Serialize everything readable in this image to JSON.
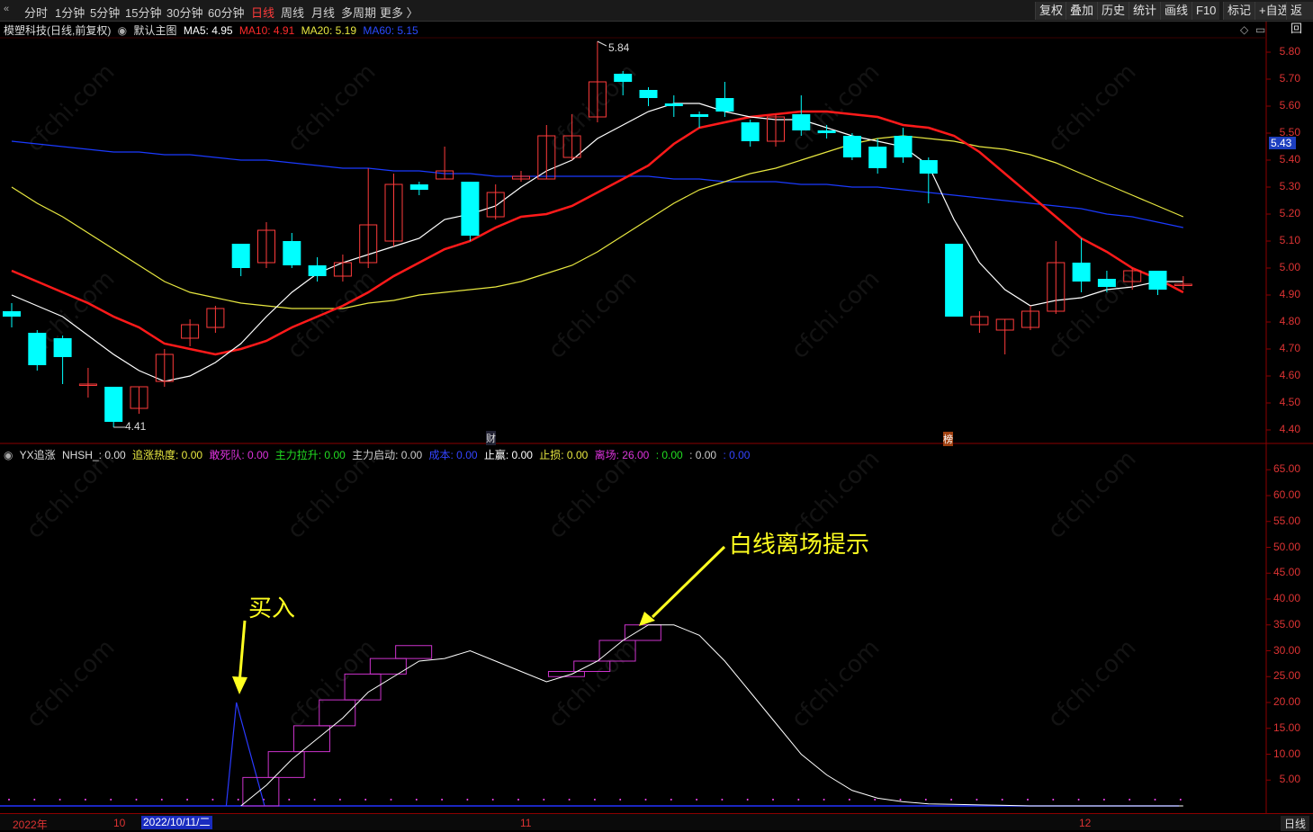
{
  "toolbar": {
    "back_arrow": "«",
    "timeframes": [
      "分时",
      "1分钟",
      "5分钟",
      "15分钟",
      "30分钟",
      "60分钟",
      "日线",
      "周线",
      "月线",
      "多周期",
      "更多 〉"
    ],
    "active_timeframe": "日线",
    "tools": [
      "复权",
      "叠加",
      "历史",
      "统计",
      "画线",
      "F10",
      "标记",
      "+自选",
      "返回"
    ]
  },
  "main_legend": {
    "stock": "模塑科技(日线,前复权)",
    "template": "默认主图",
    "ma5": "MA5: 4.95",
    "ma10": "MA10: 4.91",
    "ma20": "MA20: 5.19",
    "ma60": "MA60: 5.15"
  },
  "indicator_legend": {
    "name": "YX追涨",
    "nhsh": "NHSH_: 0.00",
    "chase_heat": "追涨热度: 0.00",
    "dare_die": "敢死队: 0.00",
    "main_up": "主力拉升: 0.00",
    "main_start": "主力启动: 0.00",
    "cost": "成本: 0.00",
    "take_profit": "止赢: 0.00",
    "stop_loss": "止损: 0.00",
    "exit": "离场: 26.00",
    "v1": ": 0.00",
    "v2": ": 0.00",
    "v3": ": 0.00"
  },
  "price_axis": [
    "5.80",
    "5.70",
    "5.60",
    "5.50",
    "5.40",
    "5.30",
    "5.20",
    "5.10",
    "5.00",
    "4.90",
    "4.80",
    "4.70",
    "4.60",
    "4.50",
    "4.40"
  ],
  "current_price": "5.43",
  "high_label": "5.84",
  "low_label": "4.41",
  "indicator_axis": [
    "65.00",
    "60.00",
    "55.00",
    "50.00",
    "45.00",
    "40.00",
    "35.00",
    "30.00",
    "25.00",
    "20.00",
    "15.00",
    "10.00",
    "5.00"
  ],
  "markers": {
    "cai": "财",
    "bang": "榜"
  },
  "annotations": {
    "buy": "买入",
    "exit_hint": "白线离场提示"
  },
  "dates": {
    "year": "2022年",
    "m10": "10",
    "selected": "2022/10/11/二",
    "m11": "11",
    "m12": "12"
  },
  "period": "日线",
  "watermark": "cfchi.com",
  "colors": {
    "up": "#ff3b3b",
    "down": "#00ffff",
    "ma5": "#ffffff",
    "ma10": "#ff1a1a",
    "ma20": "#e8e840",
    "ma60": "#1a3aff",
    "exit_steps": "#cc33cc"
  },
  "chart_data": {
    "type": "candlestick",
    "ylim": [
      4.35,
      5.88
    ],
    "candles": [
      [
        4.84,
        4.82,
        4.87,
        4.78
      ],
      [
        4.76,
        4.64,
        4.77,
        4.62
      ],
      [
        4.74,
        4.67,
        4.75,
        4.57
      ],
      [
        4.57,
        4.57,
        4.63,
        4.52
      ],
      [
        4.56,
        4.43,
        4.56,
        4.41
      ],
      [
        4.48,
        4.56,
        4.56,
        4.46
      ],
      [
        4.58,
        4.68,
        4.7,
        4.56
      ],
      [
        4.74,
        4.79,
        4.81,
        4.71
      ],
      [
        4.78,
        4.85,
        4.86,
        4.76
      ],
      [
        5.09,
        5.0,
        5.09,
        4.97
      ],
      [
        5.02,
        5.14,
        5.17,
        5.0
      ],
      [
        5.1,
        5.01,
        5.13,
        5.0
      ],
      [
        5.01,
        4.97,
        5.04,
        4.95
      ],
      [
        4.97,
        5.02,
        5.05,
        4.95
      ],
      [
        5.02,
        5.16,
        5.37,
        5.0
      ],
      [
        5.1,
        5.31,
        5.35,
        5.08
      ],
      [
        5.31,
        5.29,
        5.32,
        5.27
      ],
      [
        5.33,
        5.36,
        5.45,
        5.33
      ],
      [
        5.32,
        5.12,
        5.32,
        5.1
      ],
      [
        5.19,
        5.28,
        5.31,
        5.18
      ],
      [
        5.33,
        5.34,
        5.36,
        5.32
      ],
      [
        5.33,
        5.49,
        5.53,
        5.33
      ],
      [
        5.41,
        5.49,
        5.57,
        5.4
      ],
      [
        5.56,
        5.69,
        5.84,
        5.54
      ],
      [
        5.72,
        5.69,
        5.73,
        5.64
      ],
      [
        5.66,
        5.63,
        5.67,
        5.6
      ],
      [
        5.61,
        5.6,
        5.64,
        5.56
      ],
      [
        5.57,
        5.56,
        5.58,
        5.52
      ],
      [
        5.63,
        5.58,
        5.69,
        5.56
      ],
      [
        5.54,
        5.47,
        5.55,
        5.45
      ],
      [
        5.47,
        5.56,
        5.57,
        5.45
      ],
      [
        5.57,
        5.51,
        5.64,
        5.49
      ],
      [
        5.51,
        5.5,
        5.53,
        5.48
      ],
      [
        5.49,
        5.41,
        5.5,
        5.4
      ],
      [
        5.45,
        5.37,
        5.48,
        5.35
      ],
      [
        5.49,
        5.41,
        5.52,
        5.39
      ],
      [
        5.4,
        5.35,
        5.41,
        5.24
      ],
      [
        5.09,
        4.82,
        5.09,
        4.82
      ],
      [
        4.79,
        4.82,
        4.84,
        4.76
      ],
      [
        4.77,
        4.81,
        4.81,
        4.68
      ],
      [
        4.78,
        4.84,
        4.86,
        4.77
      ],
      [
        4.84,
        5.02,
        5.1,
        4.83
      ],
      [
        5.02,
        4.95,
        5.11,
        4.91
      ],
      [
        4.96,
        4.93,
        4.99,
        4.91
      ],
      [
        4.95,
        4.99,
        5.0,
        4.92
      ],
      [
        4.99,
        4.92,
        4.99,
        4.9
      ],
      [
        4.94,
        4.94,
        4.97,
        4.92
      ]
    ],
    "ma5": [
      4.9,
      4.86,
      4.82,
      4.75,
      4.68,
      4.62,
      4.58,
      4.6,
      4.65,
      4.72,
      4.82,
      4.91,
      4.98,
      5.02,
      5.05,
      5.08,
      5.11,
      5.18,
      5.2,
      5.23,
      5.3,
      5.36,
      5.4,
      5.48,
      5.53,
      5.58,
      5.61,
      5.61,
      5.58,
      5.56,
      5.55,
      5.55,
      5.52,
      5.49,
      5.47,
      5.45,
      5.38,
      5.18,
      5.02,
      4.92,
      4.86,
      4.88,
      4.89,
      4.92,
      4.93,
      4.95,
      4.95
    ],
    "ma10": [
      4.99,
      4.95,
      4.91,
      4.87,
      4.82,
      4.78,
      4.72,
      4.7,
      4.68,
      4.7,
      4.73,
      4.78,
      4.82,
      4.86,
      4.91,
      4.97,
      5.02,
      5.07,
      5.1,
      5.15,
      5.19,
      5.2,
      5.23,
      5.28,
      5.33,
      5.38,
      5.46,
      5.52,
      5.54,
      5.56,
      5.57,
      5.58,
      5.58,
      5.57,
      5.56,
      5.53,
      5.52,
      5.49,
      5.43,
      5.35,
      5.27,
      5.19,
      5.11,
      5.06,
      5.0,
      4.96,
      4.91
    ],
    "ma20": [
      5.3,
      5.24,
      5.19,
      5.13,
      5.07,
      5.01,
      4.95,
      4.91,
      4.89,
      4.87,
      4.86,
      4.85,
      4.85,
      4.85,
      4.87,
      4.88,
      4.9,
      4.91,
      4.92,
      4.93,
      4.95,
      4.98,
      5.01,
      5.06,
      5.12,
      5.18,
      5.24,
      5.29,
      5.32,
      5.35,
      5.37,
      5.4,
      5.43,
      5.46,
      5.48,
      5.49,
      5.48,
      5.47,
      5.45,
      5.44,
      5.42,
      5.39,
      5.35,
      5.31,
      5.27,
      5.23,
      5.19
    ],
    "ma60": [
      5.47,
      5.46,
      5.45,
      5.44,
      5.43,
      5.43,
      5.42,
      5.42,
      5.41,
      5.4,
      5.4,
      5.39,
      5.38,
      5.37,
      5.37,
      5.36,
      5.36,
      5.35,
      5.35,
      5.34,
      5.34,
      5.34,
      5.34,
      5.34,
      5.34,
      5.34,
      5.33,
      5.33,
      5.32,
      5.32,
      5.32,
      5.31,
      5.31,
      5.3,
      5.3,
      5.29,
      5.28,
      5.27,
      5.26,
      5.25,
      5.24,
      5.23,
      5.22,
      5.2,
      5.19,
      5.17,
      5.15
    ],
    "indicator_ylim": [
      0,
      68
    ],
    "indicator_white": [
      null,
      null,
      null,
      null,
      null,
      null,
      null,
      null,
      null,
      0,
      4,
      9,
      13,
      17,
      22,
      25,
      28,
      28.5,
      30,
      28,
      26,
      24,
      25.5,
      28,
      32,
      35,
      35,
      33,
      28,
      22,
      16,
      10,
      6,
      3,
      1.5,
      0.8,
      0.4,
      0.3,
      0.2,
      0.1,
      0,
      0,
      0,
      0,
      0,
      0,
      0
    ],
    "indicator_steps": [
      [
        9.5,
        0,
        5.5
      ],
      [
        10.5,
        5.5,
        10.5
      ],
      [
        11.5,
        10.5,
        15.5
      ],
      [
        12.5,
        15.5,
        20.5
      ],
      [
        13.5,
        20.5,
        25.5
      ],
      [
        14.5,
        25.5,
        28.5
      ],
      [
        15.5,
        28.5,
        31
      ],
      [
        21.5,
        25,
        26
      ],
      [
        22.5,
        26,
        28
      ],
      [
        23.5,
        28,
        32
      ],
      [
        24.5,
        32,
        35
      ]
    ],
    "indicator_blue_peak": 20
  }
}
